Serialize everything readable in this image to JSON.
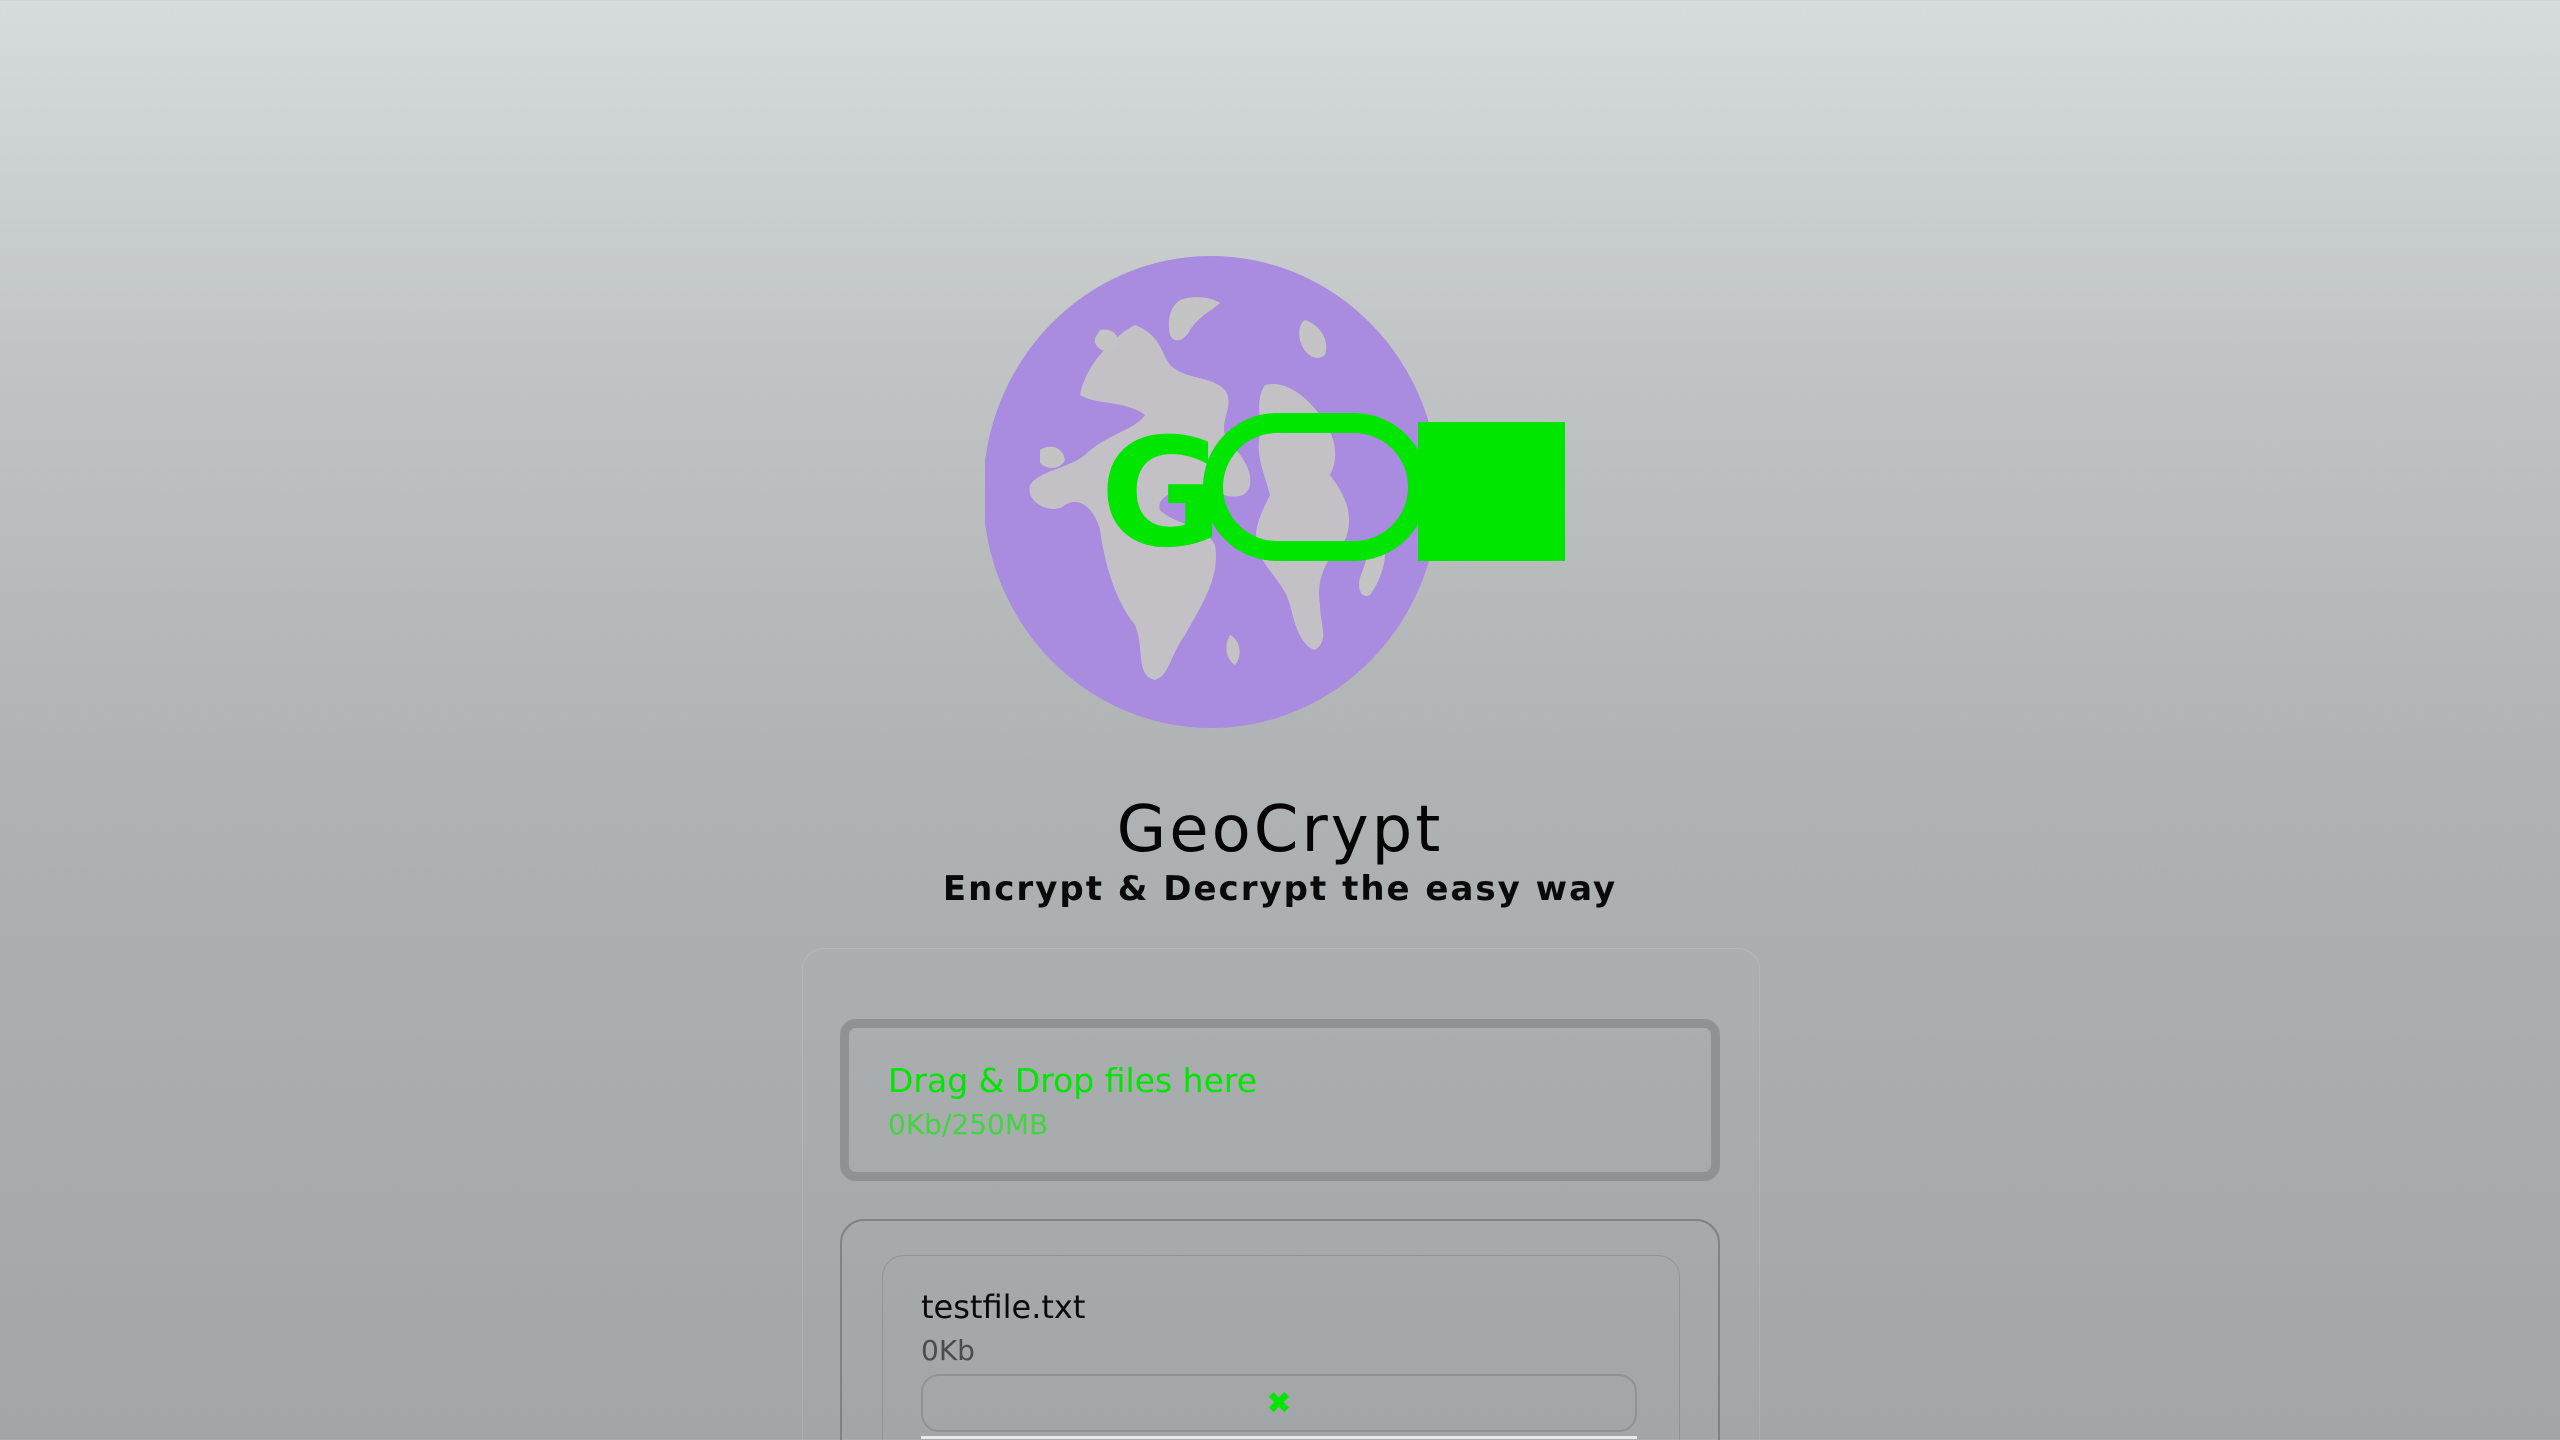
{
  "app": {
    "title": "GeoCrypt",
    "subtitle": "Encrypt & Decrypt the easy way",
    "logo_letter": "G",
    "logo_icon": "globe-key-icon",
    "colors": {
      "globe": "#a98be0",
      "globe_land": "#c4c4c4",
      "accent": "#00e600"
    }
  },
  "dropzone": {
    "label": "Drag & Drop files here",
    "size": "0Kb/250MB"
  },
  "files": [
    {
      "name": "testfile.txt",
      "size": "0Kb",
      "remove_icon": "✖"
    }
  ]
}
